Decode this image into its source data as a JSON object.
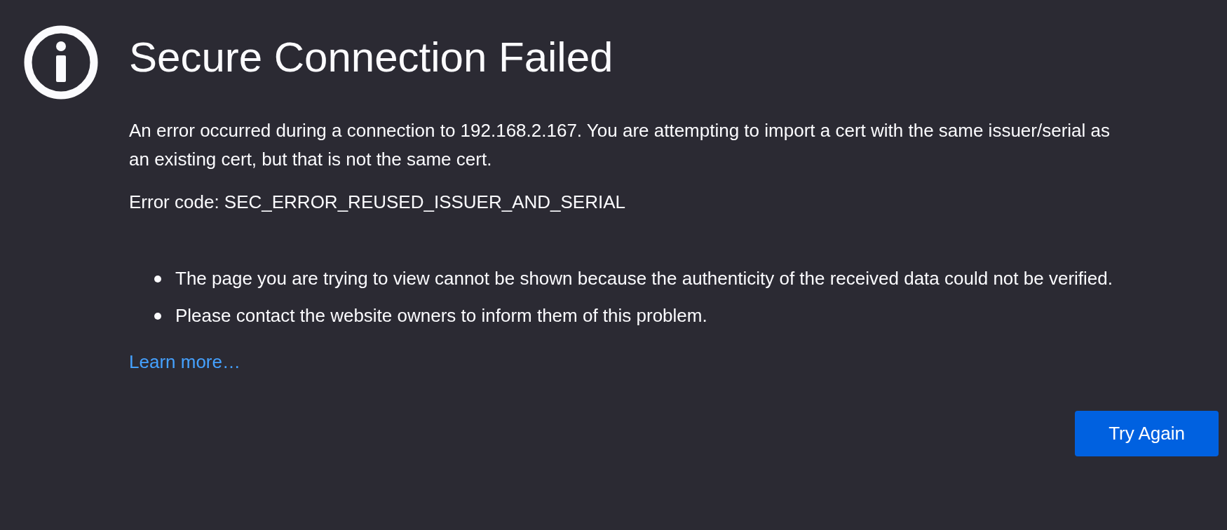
{
  "title": "Secure Connection Failed",
  "description": "An error occurred during a connection to 192.168.2.167. You are attempting to import a cert with the same issuer/serial as an existing cert, but that is not the same cert.",
  "error_code": "Error code: SEC_ERROR_REUSED_ISSUER_AND_SERIAL",
  "bullets": [
    "The page you are trying to view cannot be shown because the authenticity of the received data could not be verified.",
    "Please contact the website owners to inform them of this problem."
  ],
  "link": "Learn more…",
  "button": "Try Again"
}
